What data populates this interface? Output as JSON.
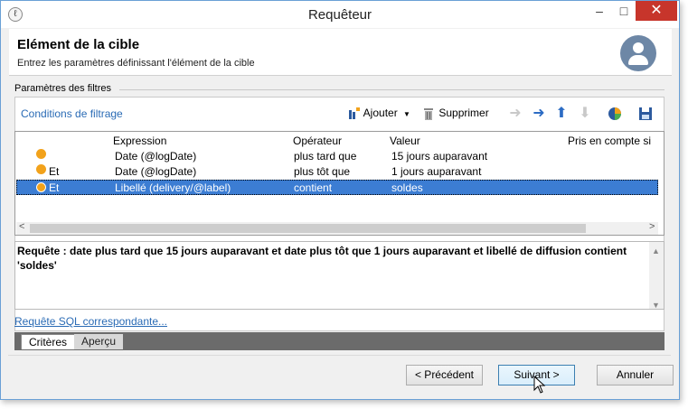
{
  "window": {
    "title": "Requêteur",
    "controls": {
      "minimize": "–",
      "maximize": "□",
      "close": "✕"
    }
  },
  "header": {
    "title": "Elément de la cible",
    "subtitle": "Entrez les paramètres définissant l'élément de la cible"
  },
  "filters": {
    "section_label": "Paramètres des filtres",
    "conditions_link": "Conditions de filtrage",
    "toolbar": {
      "add_label": "Ajouter",
      "delete_label": "Supprimer"
    },
    "columns": [
      "Expression",
      "Opérateur",
      "Valeur",
      "Pris en compte si"
    ],
    "rows": [
      {
        "connector": "",
        "expression": "Date (@logDate)",
        "operator": "plus tard que",
        "value": "15 jours auparavant",
        "selected": false
      },
      {
        "connector": "Et",
        "expression": "Date (@logDate)",
        "operator": "plus tôt que",
        "value": "1 jours auparavant",
        "selected": false
      },
      {
        "connector": "Et",
        "expression": "Libellé (delivery/@label)",
        "operator": "contient",
        "value": "soldes",
        "selected": true
      }
    ]
  },
  "query": {
    "text": "Requête : date plus tard que 15 jours auparavant et date plus tôt que 1 jours auparavant et libellé de diffusion contient 'soldes'"
  },
  "sql_link": "Requête SQL correspondante...",
  "tabs": [
    {
      "label": "Critères",
      "active": true
    },
    {
      "label": "Aperçu",
      "active": false
    }
  ],
  "buttons": {
    "previous": "< Précédent",
    "next": "Suivant >",
    "cancel": "Annuler"
  },
  "colors": {
    "selection": "#3c7dd3",
    "link": "#2a6bb5",
    "close_button": "#c7352b",
    "condition_dot": "#f2a21b"
  }
}
